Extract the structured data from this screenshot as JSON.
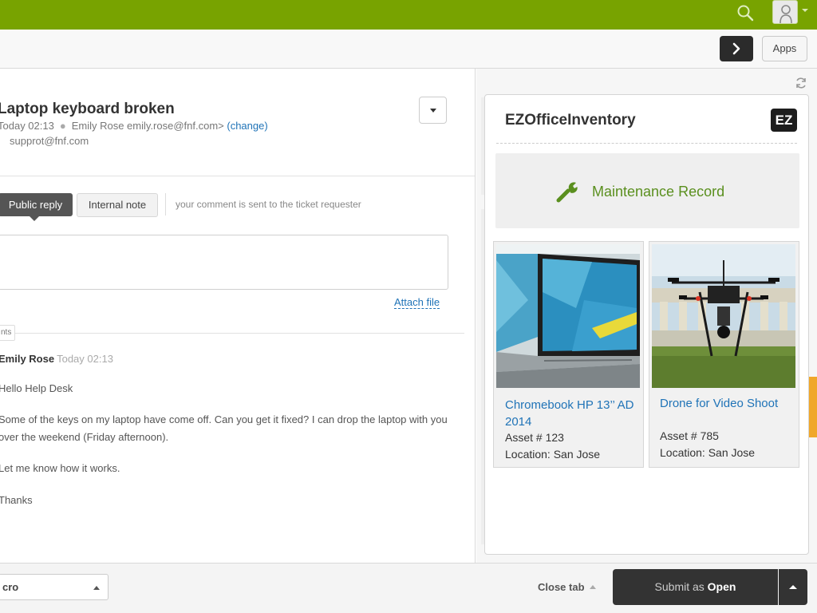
{
  "topbar": {
    "bg_color": "#78a300",
    "search_icon": "search-icon",
    "avatar_icon": "user-avatar-icon"
  },
  "toolbar": {
    "next_icon": "chevron-right-icon",
    "apps_label": "Apps"
  },
  "ticket": {
    "title": "Laptop keyboard broken",
    "time": "Today 02:13",
    "requester": "Emily Rose emily.rose@fnf.com>",
    "change_label": "(change)",
    "cc": "supprot@fnf.com",
    "reply_tabs": {
      "public": "Public reply",
      "internal": "Internal note"
    },
    "reply_hint": "your comment is sent to the ticket requester",
    "reply_value": "",
    "attach_label": "Attach file",
    "comments_label": "nts",
    "comment": {
      "author": "Emily Rose",
      "time": "Today 02:13",
      "paragraphs": [
        "Hello Help Desk",
        "Some of the keys on my laptop have come off. Can you get it fixed? I can drop the laptop with you over the weekend (Friday afternoon).",
        "Let me know how it works.",
        "Thanks"
      ]
    }
  },
  "app": {
    "title": "EZOfficeInventory",
    "logo_text": "EZ",
    "maintenance_label": "Maintenance Record",
    "maintenance_icon": "wrench-icon",
    "accent_color": "#5a8f1e",
    "assets": [
      {
        "name": "Chromebook  HP 13’’ AD 2014",
        "asset_no": "Asset # 123",
        "location": "Location: San Jose",
        "image": "laptop-image"
      },
      {
        "name": "Drone for Video Shoot",
        "asset_no": "Asset # 785",
        "location": "Location: San Jose",
        "image": "drone-image"
      }
    ]
  },
  "footer": {
    "macro_value": "cro",
    "close_tab_label": "Close tab",
    "submit_prefix": "Submit as",
    "submit_status": "Open"
  }
}
